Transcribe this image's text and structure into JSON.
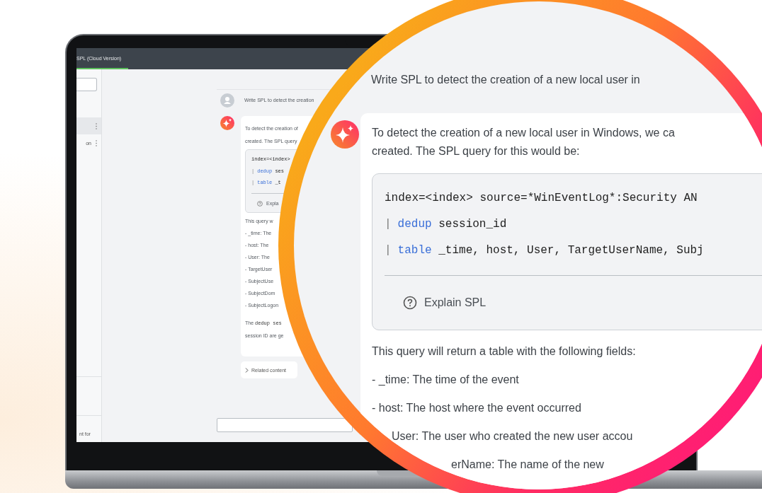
{
  "laptop_screen": {
    "tab": {
      "label": "SPL (Cloud Version)",
      "selected": true
    },
    "sidebar": {
      "items": [
        {
          "selected": true
        },
        {
          "label": "on",
          "selected": false
        }
      ],
      "footer_text": "nt for"
    },
    "chat": {
      "user_message": "Write SPL to detect the creation",
      "answer": {
        "intro": [
          "To detect the creation of",
          "created. The SPL query"
        ],
        "code": [
          {
            "rest": "index=<index>"
          },
          {
            "pipe": "|",
            "keyword": "dedup",
            "rest": "ses"
          },
          {
            "pipe": "|",
            "keyword": "table",
            "rest": "_t"
          }
        ],
        "explain": "Expla",
        "summary": "This query w",
        "fields": [
          "- _time: The",
          "- host: The",
          "- User: The",
          "- TargetUser",
          "- SubjectUse",
          "- SubjectDom",
          "- SubjectLogon"
        ],
        "outro": [
          {
            "text": "The ",
            "code": "dedup ses"
          },
          {
            "text": "session ID are ge"
          }
        ]
      },
      "related": "Related content"
    }
  },
  "magnifier": {
    "user_message": "Write SPL to detect the creation of a new local user in",
    "answer": {
      "intro": [
        "To detect the creation of a new local user in Windows, we ca",
        "created. The SPL query for this would be:"
      ],
      "code": [
        {
          "rest": "index=<index> source=*WinEventLog*:Security AN"
        },
        {
          "pipe": "|",
          "keyword": "dedup",
          "rest": "session_id"
        },
        {
          "pipe": "|",
          "keyword": "table",
          "rest": "_time, host, User, TargetUserName, Subj"
        }
      ],
      "explain": "Explain SPL",
      "summary": "This query will return a table with the following fields:",
      "fields": [
        "- _time: The time of the event",
        "- host: The host where the event occurred",
        "User: The user who created the new user accou",
        "erName: The name of the new"
      ]
    }
  }
}
